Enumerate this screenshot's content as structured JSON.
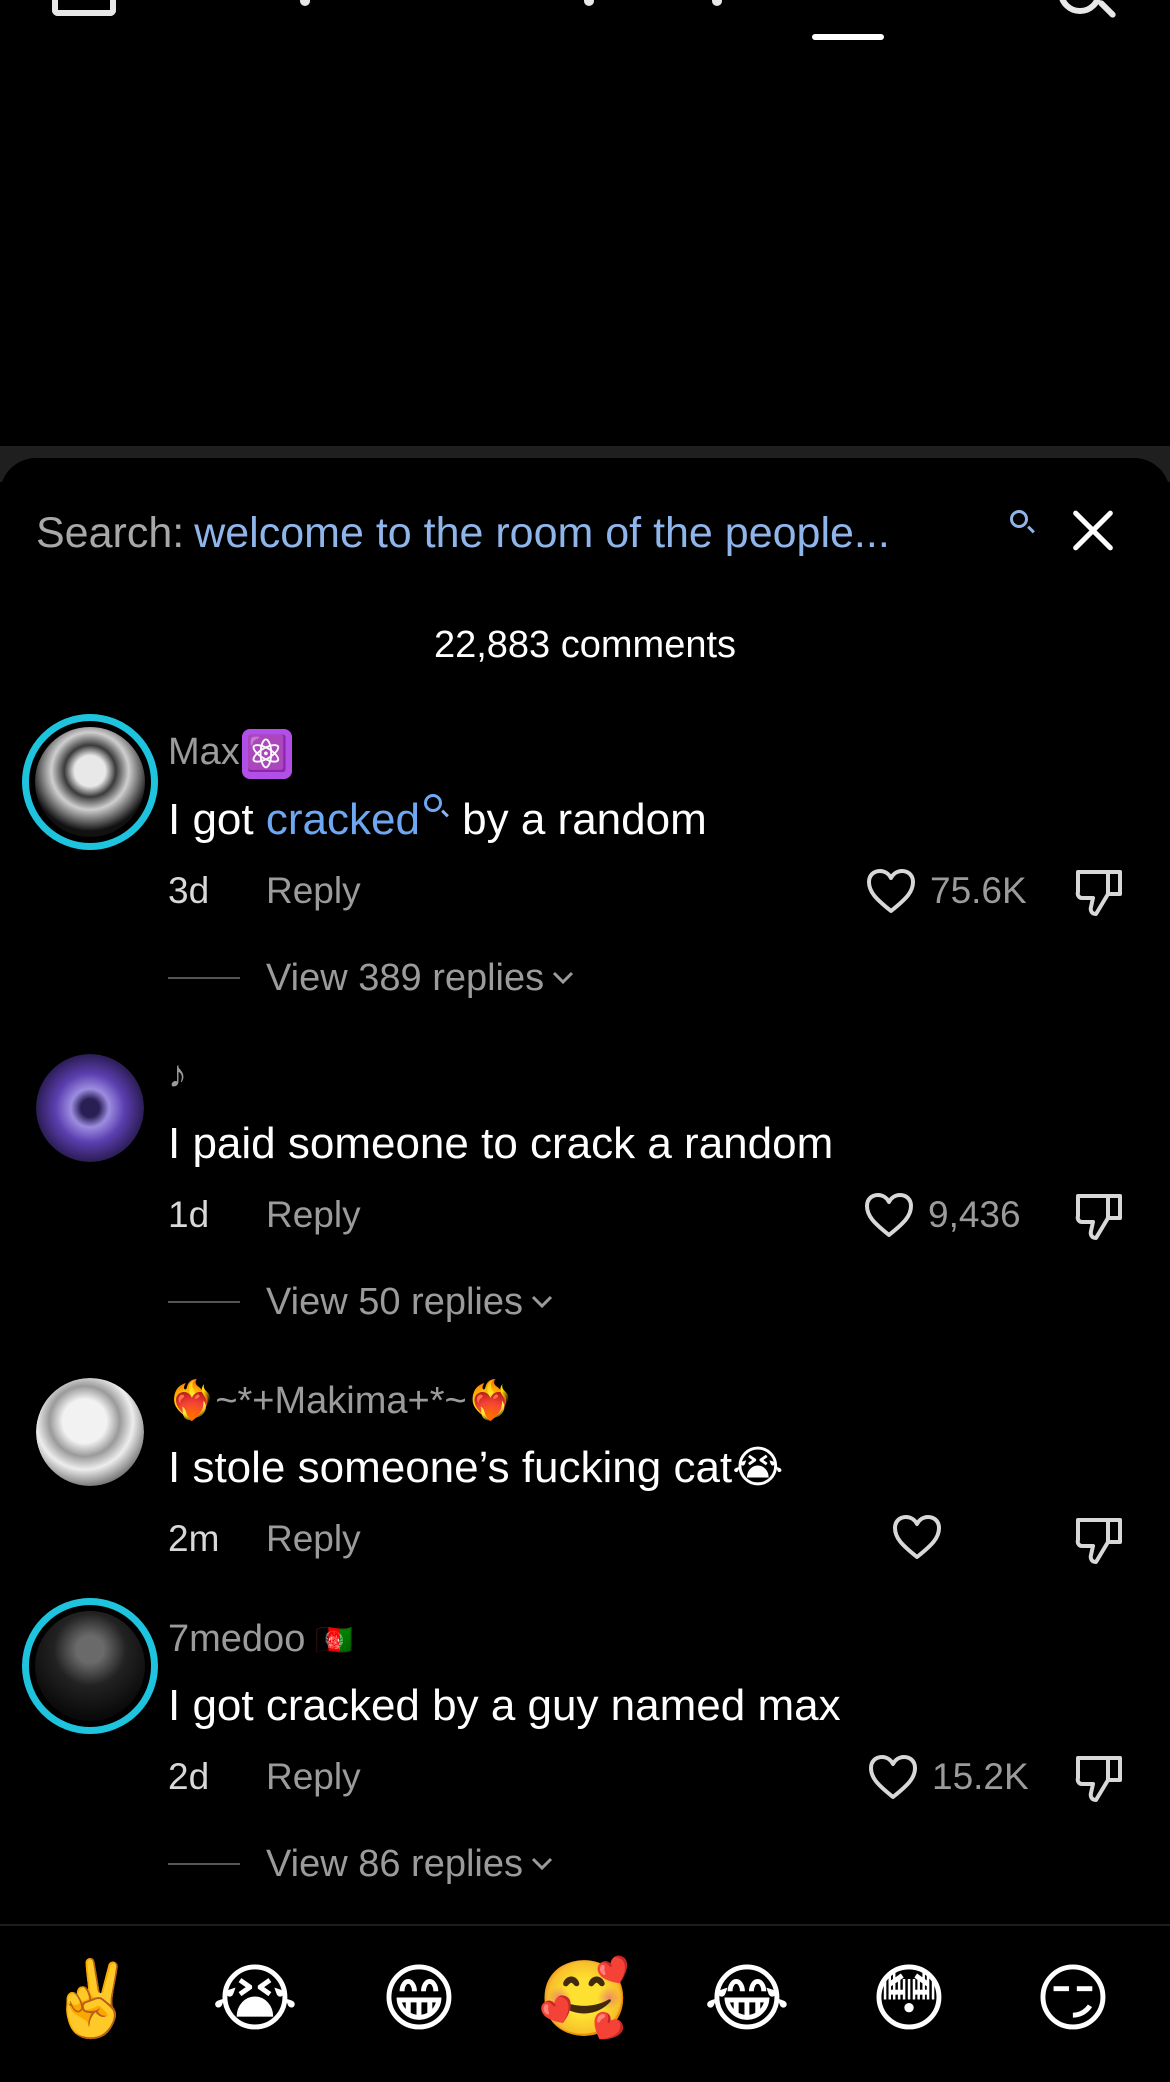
{
  "search": {
    "label": "Search:",
    "query": "welcome to the room of the people..."
  },
  "comments_count": "22,883 comments",
  "comments": [
    {
      "username": "Max",
      "badge": "⚛️",
      "text_before": "I got ",
      "text_link": "cracked",
      "text_after": " by a random",
      "age": "3d",
      "reply_label": "Reply",
      "likes": "75.6K",
      "view_replies": "View 389 replies",
      "avatar_ring": true
    },
    {
      "username": "♪",
      "text": "I paid someone to crack a random",
      "age": "1d",
      "reply_label": "Reply",
      "likes": "9,436",
      "view_replies": "View 50 replies"
    },
    {
      "username": "❤️‍🔥~*+Makima+*~❤️‍🔥",
      "text": "I stole someone’s fucking cat😭",
      "age": "2m",
      "reply_label": "Reply",
      "likes": ""
    },
    {
      "username": "7medoo",
      "badge": "🇦🇫",
      "text": "I got cracked by a guy named max",
      "age": "2d",
      "reply_label": "Reply",
      "likes": "15.2K",
      "view_replies": "View 86 replies",
      "avatar_ring": true
    }
  ],
  "emoji_bar": [
    "✌️",
    "😭",
    "😁",
    "🥰",
    "😂",
    "😳",
    "😏"
  ],
  "colors": {
    "background": "#000000",
    "link_blue": "#6ea8f2",
    "search_query": "#8fb5ea",
    "ring": "#1ec4dd",
    "muted": "#9b9b9b"
  }
}
